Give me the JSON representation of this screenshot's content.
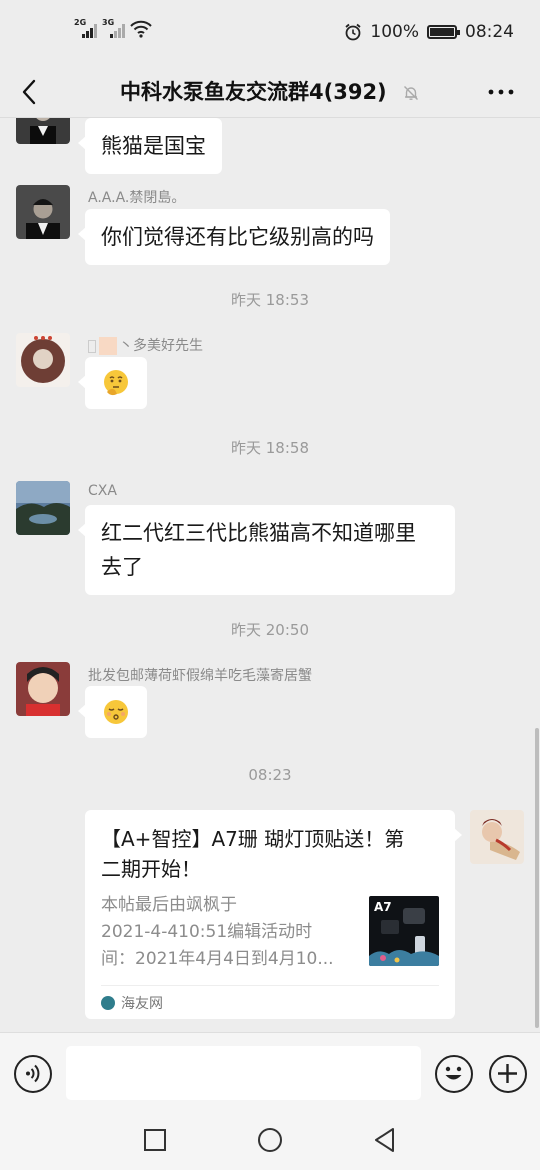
{
  "status": {
    "signal1": "2G",
    "signal2": "3G",
    "battery": "100%",
    "time": "08:24"
  },
  "header": {
    "title": "中科水泵鱼友交流群4(392)"
  },
  "messages": [
    {
      "text": "熊猫是国宝"
    },
    {
      "sender": "A.A.A.禁閉島。",
      "text": "你们觉得还有比它级别高的吗"
    },
    {
      "sender": "丶多美好先生",
      "emoji": "thinking-face"
    },
    {
      "sender": "CXA",
      "text_line1": "红二代红三代比熊猫高不知道哪里",
      "text_line2": "去了"
    },
    {
      "sender": "批发包邮薄荷虾假绵羊吃毛藻寄居蟹",
      "emoji": "kissing-face"
    }
  ],
  "timestamps": [
    "昨天 18:53",
    "昨天 18:58",
    "昨天 20:50",
    "08:23"
  ],
  "card": {
    "title_line1": "【A+智控】A7珊 瑚灯顶贴送！第",
    "title_line2": "二期开始！",
    "desc_line1": "本帖最后由飒枫于",
    "desc_line2": "2021-4-410:51编辑活动时",
    "desc_line3": "间：2021年4月4日到4月10...",
    "thumb_label": "A7",
    "source": "海友网"
  },
  "icons": {
    "back": "back-arrow-icon",
    "mute": "bell-off-icon",
    "more": "more-icon",
    "voice": "voice-icon",
    "emoji": "emoji-icon",
    "plus": "plus-icon"
  },
  "colors": {
    "background": "#ededed",
    "bubble": "#ffffff",
    "meta_text": "#9a9a9a"
  }
}
